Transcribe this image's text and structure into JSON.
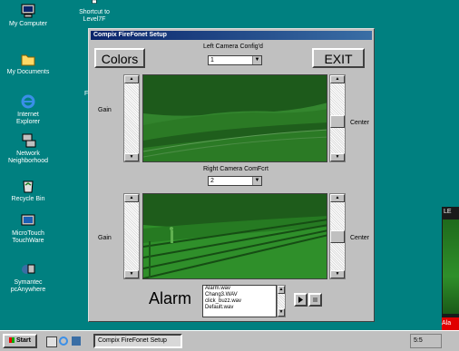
{
  "desktop": {
    "icons": [
      {
        "label": "My Computer",
        "icon": "computer-icon"
      },
      {
        "label": "Shortcut to\nLevel7F",
        "icon": "shortcut-icon"
      },
      {
        "label": "My Documents",
        "icon": "folder-icon"
      },
      {
        "label": "Internet\nExplorer",
        "icon": "ie-icon"
      },
      {
        "label": "Network\nNeighborhood",
        "icon": "network-icon"
      },
      {
        "label": "Recycle Bin",
        "icon": "recycle-icon"
      },
      {
        "label": "MicroTouch\nTouchWare",
        "icon": "touch-icon"
      },
      {
        "label": "Symantec\npcAnywhere",
        "icon": "pca-icon"
      }
    ],
    "behind_window_letter": "F",
    "side_window_title": "LE",
    "side_alarm": "Ala"
  },
  "window": {
    "title": "Compix FireFonet Setup",
    "colors_label": "Colors",
    "exit_label": "EXIT",
    "left_camera_caption": "Left Camera Config'd",
    "left_camera_value": "1",
    "right_camera_caption": "Right Camera ComFcrt",
    "right_camera_value": "2",
    "gain_label": "Gain",
    "center_label": "Center",
    "alarm_label": "Alarm",
    "alarm_options": [
      "Alarm.wav",
      "Chang3.WAV",
      "click_buzz.wav",
      "Default.wav"
    ],
    "play_icon": "play-icon",
    "stop_icon": "stop-icon"
  },
  "taskbar": {
    "start_label": "Start",
    "task_label": "Compix FireFonet Setup",
    "tray_text": "5:5"
  },
  "colors": {
    "desktop": "#008080",
    "camera_green": "#2f8f2a",
    "taskbar_gray": "#c0c0c0"
  }
}
